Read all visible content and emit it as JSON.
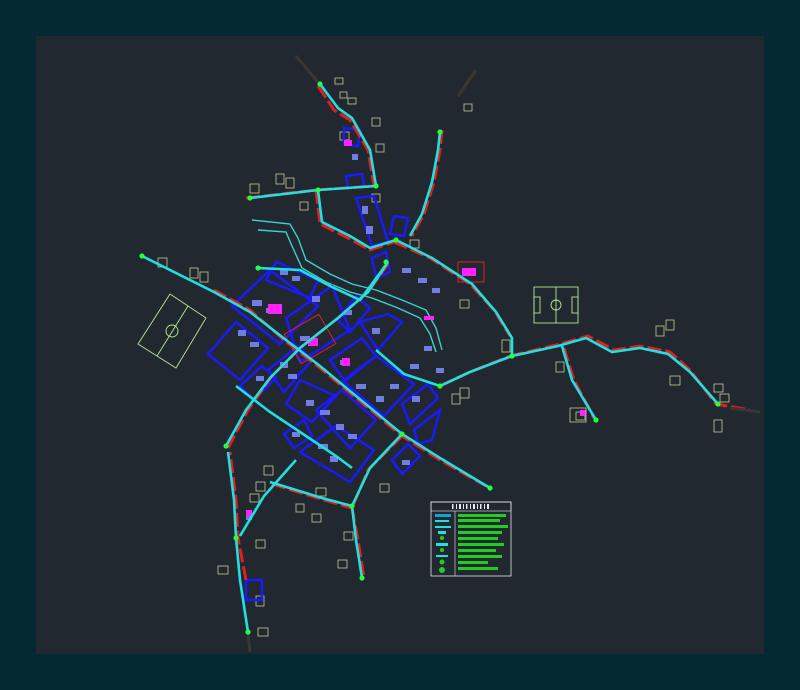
{
  "colors": {
    "page_background": "#022a30",
    "viewport_background": "#212830",
    "water_network": "#22e0e0",
    "sewer_network": "#e02020",
    "blocks": "#1a1aff",
    "buildings": "#7f8cff",
    "parcels": "#c8c890",
    "sports_fields": "#b8e890",
    "public_buildings": "#ff22ff",
    "legend_entries": "#22cc22",
    "nodes": "#22ff44",
    "river": "#40d0d0"
  },
  "legend_icons": [
    "map-grid",
    "water-line",
    "sewer-line",
    "node-marker",
    "block-outline"
  ]
}
